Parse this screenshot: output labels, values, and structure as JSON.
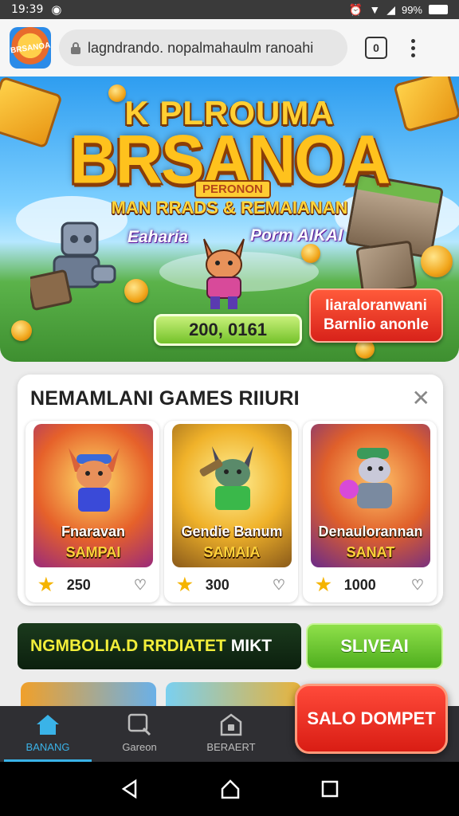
{
  "status_bar": {
    "time": "19:39",
    "battery": "99%"
  },
  "browser": {
    "url": "lagndrando. nopalmahaulm ranoahi",
    "tabs_count": "0",
    "logo_text": "BRSANOA"
  },
  "hero": {
    "title_top": "K PLROUMA",
    "title": "BRSANOA",
    "badge": "PERONON",
    "subtitle": "MAN RRADS & REMAIANAN",
    "left_label": "Eaharia",
    "right_label": "Porm AIKAI",
    "amount": "200, 0161",
    "promo_line1": "Iiaraloranwani",
    "promo_line2": "Barnlio anonle"
  },
  "games_section": {
    "title": "NEMAMLANI GAMES RIIURI",
    "games": [
      {
        "title": "Fnaravan",
        "subtitle": "SAMPAI",
        "rating": "250"
      },
      {
        "title": "Gendie Banum",
        "subtitle": "SAMAIA",
        "rating": "300"
      },
      {
        "title": "Denaulorannan",
        "subtitle": "SANAT",
        "rating": "1000"
      }
    ]
  },
  "cta": {
    "text": "NGMBOLIA.D RRDIATET",
    "text_white": "MIKT",
    "button": "SLIVEAI"
  },
  "bottom_nav": {
    "items": [
      {
        "label": "BANANG",
        "icon": "home-icon"
      },
      {
        "label": "Gareon",
        "icon": "search-icon"
      },
      {
        "label": "BERAERT",
        "icon": "lock-icon"
      }
    ],
    "wallet_button": "SALO DOMPET"
  },
  "colors": {
    "accent": "#3ab3e8",
    "brand_red": "#d91d14",
    "brand_green": "#4fae1e",
    "gold": "#ffc21d"
  }
}
